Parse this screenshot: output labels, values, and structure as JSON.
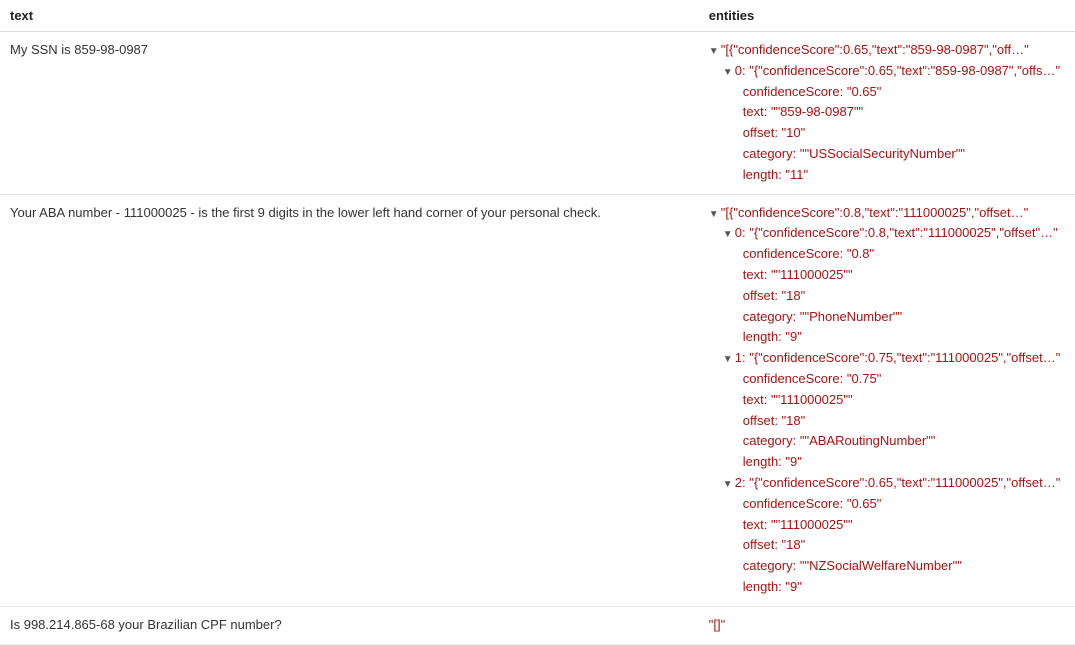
{
  "headers": {
    "text": "text",
    "entities": "entities"
  },
  "caret_down": "▼",
  "rows": [
    {
      "text": "My SSN is 859-98-0987",
      "tree": [
        {
          "indent": 0,
          "caret": true,
          "summary": "\"[{\"confidenceScore\":0.65,\"text\":\"859-98-0987\",\"off…\""
        },
        {
          "indent": 1,
          "caret": true,
          "key": "0",
          "summary": "\"{\"confidenceScore\":0.65,\"text\":\"859-98-0987\",\"offs…\""
        },
        {
          "indent": 2,
          "key": "confidenceScore",
          "value": "\"0.65\""
        },
        {
          "indent": 2,
          "key": "text",
          "value": "\"\"859-98-0987\"\""
        },
        {
          "indent": 2,
          "key": "offset",
          "value": "\"10\""
        },
        {
          "indent": 2,
          "key": "category",
          "value": "\"\"USSocialSecurityNumber\"\""
        },
        {
          "indent": 2,
          "key": "length",
          "value": "\"11\""
        }
      ]
    },
    {
      "text": "Your ABA number - 111000025 - is the first 9 digits in the lower left hand corner of your personal check.",
      "tree": [
        {
          "indent": 0,
          "caret": true,
          "summary": "\"[{\"confidenceScore\":0.8,\"text\":\"111000025\",\"offset…\""
        },
        {
          "indent": 1,
          "caret": true,
          "key": "0",
          "summary": "\"{\"confidenceScore\":0.8,\"text\":\"111000025\",\"offset\"…\""
        },
        {
          "indent": 2,
          "key": "confidenceScore",
          "value": "\"0.8\""
        },
        {
          "indent": 2,
          "key": "text",
          "value": "\"\"111000025\"\""
        },
        {
          "indent": 2,
          "key": "offset",
          "value": "\"18\""
        },
        {
          "indent": 2,
          "key": "category",
          "value": "\"\"PhoneNumber\"\""
        },
        {
          "indent": 2,
          "key": "length",
          "value": "\"9\""
        },
        {
          "indent": 1,
          "caret": true,
          "key": "1",
          "summary": "\"{\"confidenceScore\":0.75,\"text\":\"111000025\",\"offset…\""
        },
        {
          "indent": 2,
          "key": "confidenceScore",
          "value": "\"0.75\""
        },
        {
          "indent": 2,
          "key": "text",
          "value": "\"\"111000025\"\""
        },
        {
          "indent": 2,
          "key": "offset",
          "value": "\"18\""
        },
        {
          "indent": 2,
          "key": "category",
          "value": "\"\"ABARoutingNumber\"\""
        },
        {
          "indent": 2,
          "key": "length",
          "value": "\"9\""
        },
        {
          "indent": 1,
          "caret": true,
          "key": "2",
          "summary": "\"{\"confidenceScore\":0.65,\"text\":\"111000025\",\"offset…\""
        },
        {
          "indent": 2,
          "key": "confidenceScore",
          "value": "\"0.65\""
        },
        {
          "indent": 2,
          "key": "text",
          "value": "\"\"111000025\"\""
        },
        {
          "indent": 2,
          "key": "offset",
          "value": "\"18\""
        },
        {
          "indent": 2,
          "key": "category",
          "value": "\"\"NZSocialWelfareNumber\"\""
        },
        {
          "indent": 2,
          "key": "length",
          "value": "\"9\""
        }
      ]
    },
    {
      "text": "Is 998.214.865-68 your Brazilian CPF number?",
      "tree": [
        {
          "indent": 0,
          "raw": "\"[]\""
        }
      ]
    }
  ]
}
